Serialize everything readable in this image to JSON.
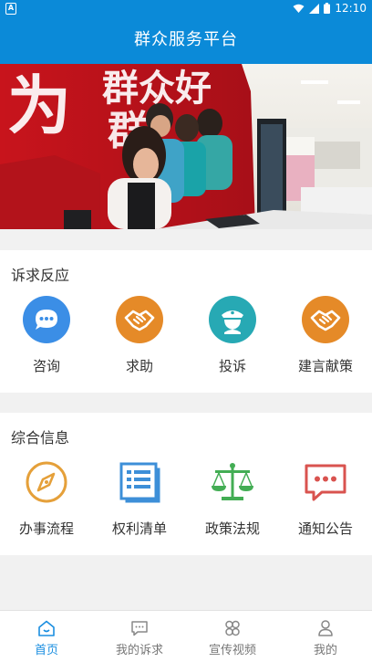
{
  "status_bar": {
    "time": "12:10"
  },
  "app_bar": {
    "title": "群众服务平台"
  },
  "banner": {
    "sign_text": "为群众好办事",
    "alt": "banner-photo"
  },
  "section_appeal": {
    "title": "诉求反应",
    "items": [
      {
        "label": "咨询",
        "icon": "chat-bubble-icon",
        "color": "#3b8ee6"
      },
      {
        "label": "求助",
        "icon": "handshake-icon",
        "color": "#e58a28"
      },
      {
        "label": "投诉",
        "icon": "officer-icon",
        "color": "#27a9b4"
      },
      {
        "label": "建言献策",
        "icon": "handshake-icon",
        "color": "#e58a28"
      }
    ]
  },
  "section_info": {
    "title": "综合信息",
    "items": [
      {
        "label": "办事流程",
        "icon": "compass-icon",
        "color": "#e5a03a"
      },
      {
        "label": "权利清单",
        "icon": "list-document-icon",
        "color": "#3d8fd8"
      },
      {
        "label": "政策法规",
        "icon": "scales-icon",
        "color": "#43ad54"
      },
      {
        "label": "通知公告",
        "icon": "message-icon",
        "color": "#d9534f"
      }
    ]
  },
  "bottom_nav": {
    "items": [
      {
        "label": "首页",
        "icon": "home-icon",
        "active": true
      },
      {
        "label": "我的诉求",
        "icon": "chat-icon",
        "active": false
      },
      {
        "label": "宣传视频",
        "icon": "clover-icon",
        "active": false
      },
      {
        "label": "我的",
        "icon": "user-icon",
        "active": false
      }
    ],
    "active_color": "#1a8ee0",
    "inactive_color": "#888888"
  }
}
